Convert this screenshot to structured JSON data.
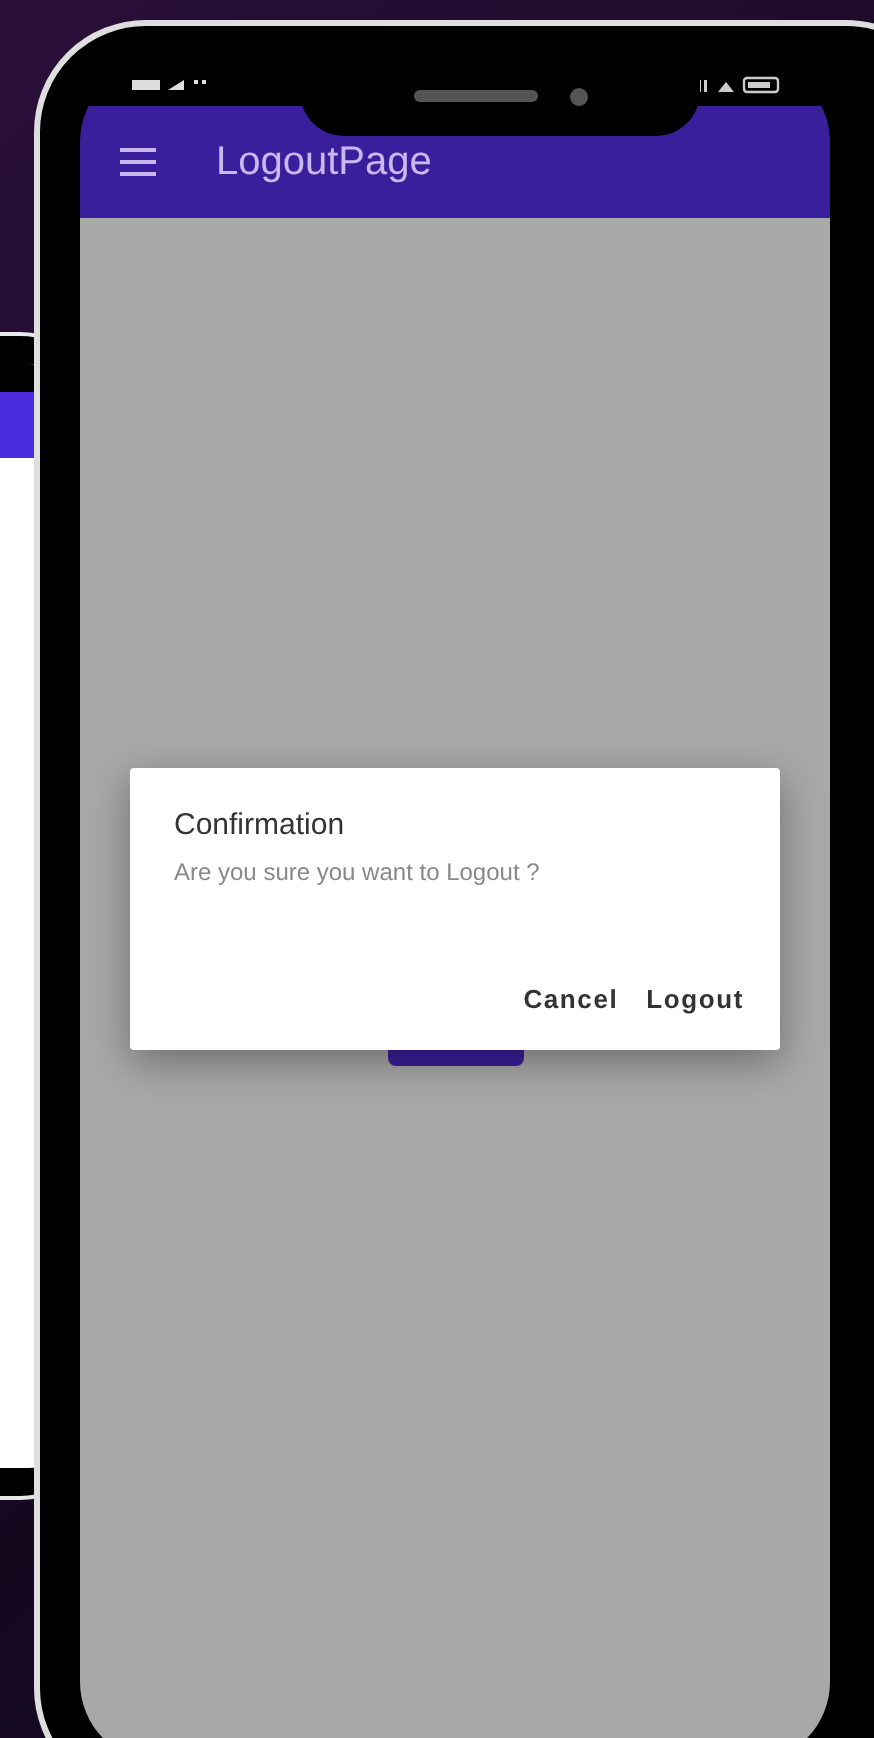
{
  "app_bar": {
    "title": "LogoutPage"
  },
  "dialog": {
    "title": "Confirmation",
    "message": "Are you sure you want to Logout ?",
    "actions": [
      "Cancel",
      "Logout"
    ]
  }
}
